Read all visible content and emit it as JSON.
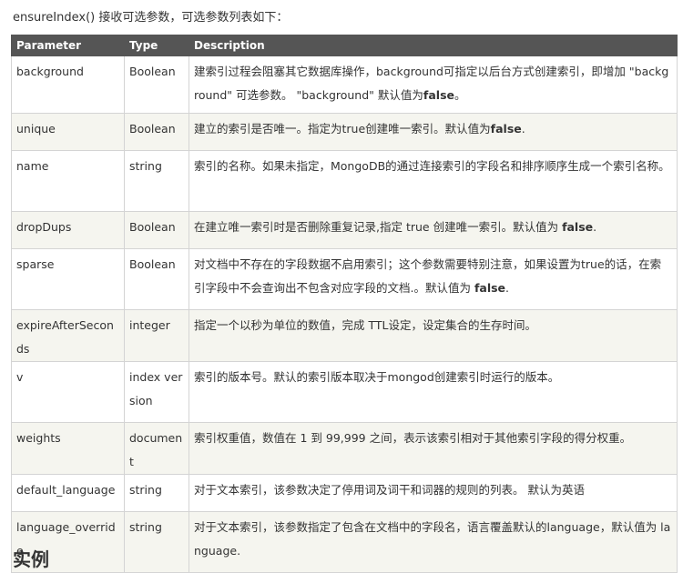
{
  "intro": "ensureIndex() 接收可选参数，可选参数列表如下：",
  "columns": [
    "Parameter",
    "Type",
    "Description"
  ],
  "rows": [
    {
      "param": "background",
      "type": "Boolean",
      "desc": "建索引过程会阻塞其它数据库操作，background可指定以后台方式创建索引，即增加 \"background\" 可选参数。 \"background\" 默认值为",
      "bold": "false",
      "tail": "。"
    },
    {
      "param": "unique",
      "type": "Boolean",
      "desc": "建立的索引是否唯一。指定为true创建唯一索引。默认值为",
      "bold": "false",
      "tail": "."
    },
    {
      "param": "name",
      "type": "string",
      "desc": "索引的名称。如果未指定，MongoDB的通过连接索引的字段名和排序顺序生成一个索引名称。",
      "bold": "",
      "tail": ""
    },
    {
      "param": "dropDups",
      "type": "Boolean",
      "desc": "在建立唯一索引时是否删除重复记录,指定 true 创建唯一索引。默认值为 ",
      "bold": "false",
      "tail": "."
    },
    {
      "param": "sparse",
      "type": "Boolean",
      "desc": "对文档中不存在的字段数据不启用索引；这个参数需要特别注意，如果设置为true的话，在索引字段中不会查询出不包含对应字段的文档.。默认值为 ",
      "bold": "false",
      "tail": "."
    },
    {
      "param": "expireAfterSeconds",
      "type": "integer",
      "desc": "指定一个以秒为单位的数值，完成 TTL设定，设定集合的生存时间。",
      "bold": "",
      "tail": ""
    },
    {
      "param": "v",
      "type": "index version",
      "desc": "索引的版本号。默认的索引版本取决于mongod创建索引时运行的版本。",
      "bold": "",
      "tail": ""
    },
    {
      "param": "weights",
      "type": "document",
      "desc": "索引权重值，数值在 1 到 99,999 之间，表示该索引相对于其他索引字段的得分权重。",
      "bold": "",
      "tail": ""
    },
    {
      "param": "default_language",
      "type": "string",
      "desc": "对于文本索引，该参数决定了停用词及词干和词器的规则的列表。 默认为英语",
      "bold": "",
      "tail": ""
    },
    {
      "param": "language_override",
      "type": "string",
      "desc": "对于文本索引，该参数指定了包含在文档中的字段名，语言覆盖默认的language，默认值为 language.",
      "bold": "",
      "tail": ""
    }
  ],
  "trailer": "实例"
}
